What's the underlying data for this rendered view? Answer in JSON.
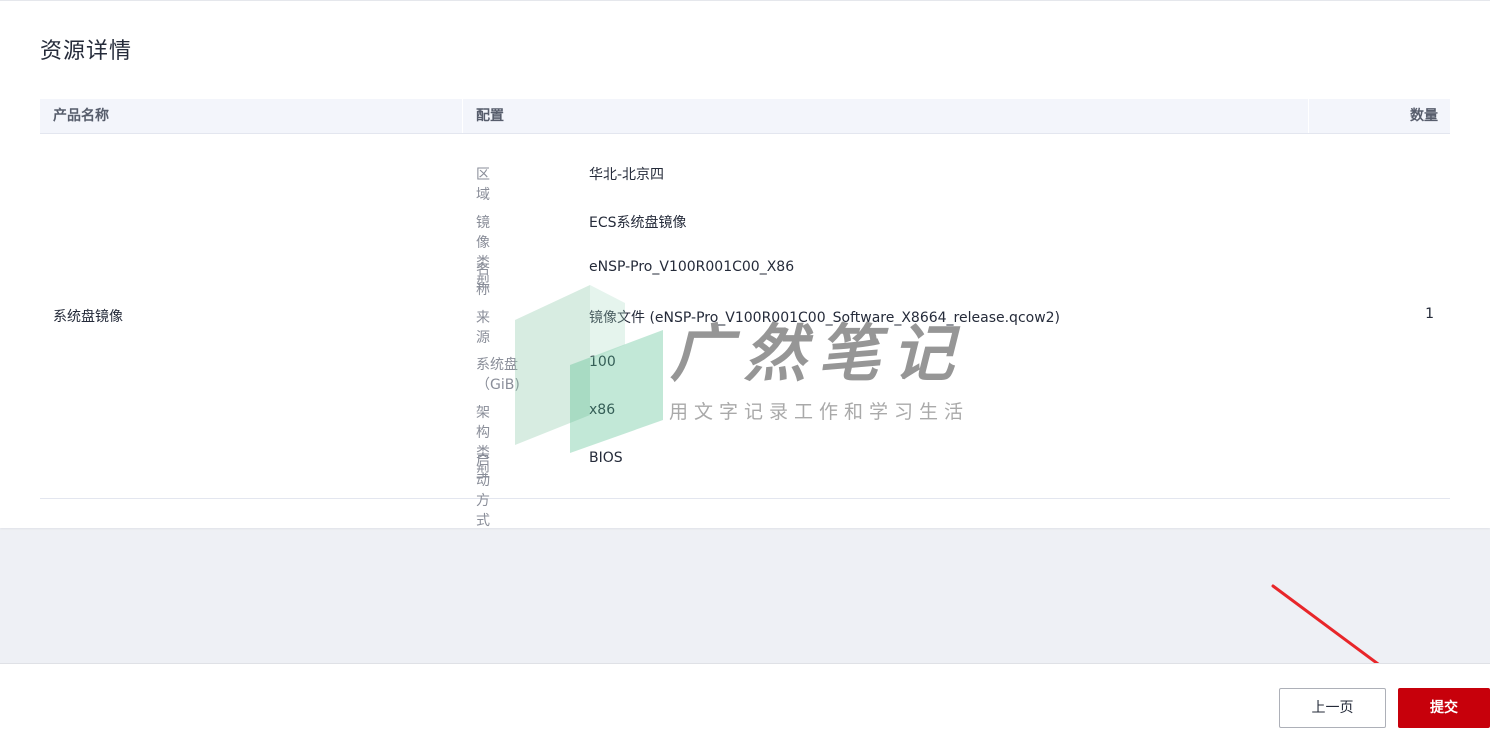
{
  "card": {
    "title": "资源详情"
  },
  "table": {
    "headers": {
      "name": "产品名称",
      "config": "配置",
      "qty": "数量"
    },
    "row": {
      "product": "系统盘镜像",
      "quantity": "1",
      "config": [
        {
          "key": "区域",
          "value": "华北-北京四"
        },
        {
          "key": "镜像类型",
          "value": "ECS系统盘镜像"
        },
        {
          "key": "名称",
          "value": "eNSP-Pro_V100R001C00_X86"
        },
        {
          "key": "来源",
          "value": "镜像文件 (eNSP-Pro_V100R001C00_Software_X8664_release.qcow2)"
        },
        {
          "key": "系统盘（GiB)",
          "value": "100"
        },
        {
          "key": "架构类型",
          "value": "x86"
        },
        {
          "key": "启动方式",
          "value": "BIOS"
        }
      ]
    }
  },
  "watermark": {
    "title": "广然笔记",
    "subtitle": "用文字记录工作和学习生活"
  },
  "footer": {
    "prev_label": "上一页",
    "submit_label": "提交"
  },
  "colors": {
    "primary": "#c7000b",
    "table_header_bg": "#f3f5fb",
    "page_bg": "#eef0f5",
    "annotation_arrow": "#e8262a"
  }
}
